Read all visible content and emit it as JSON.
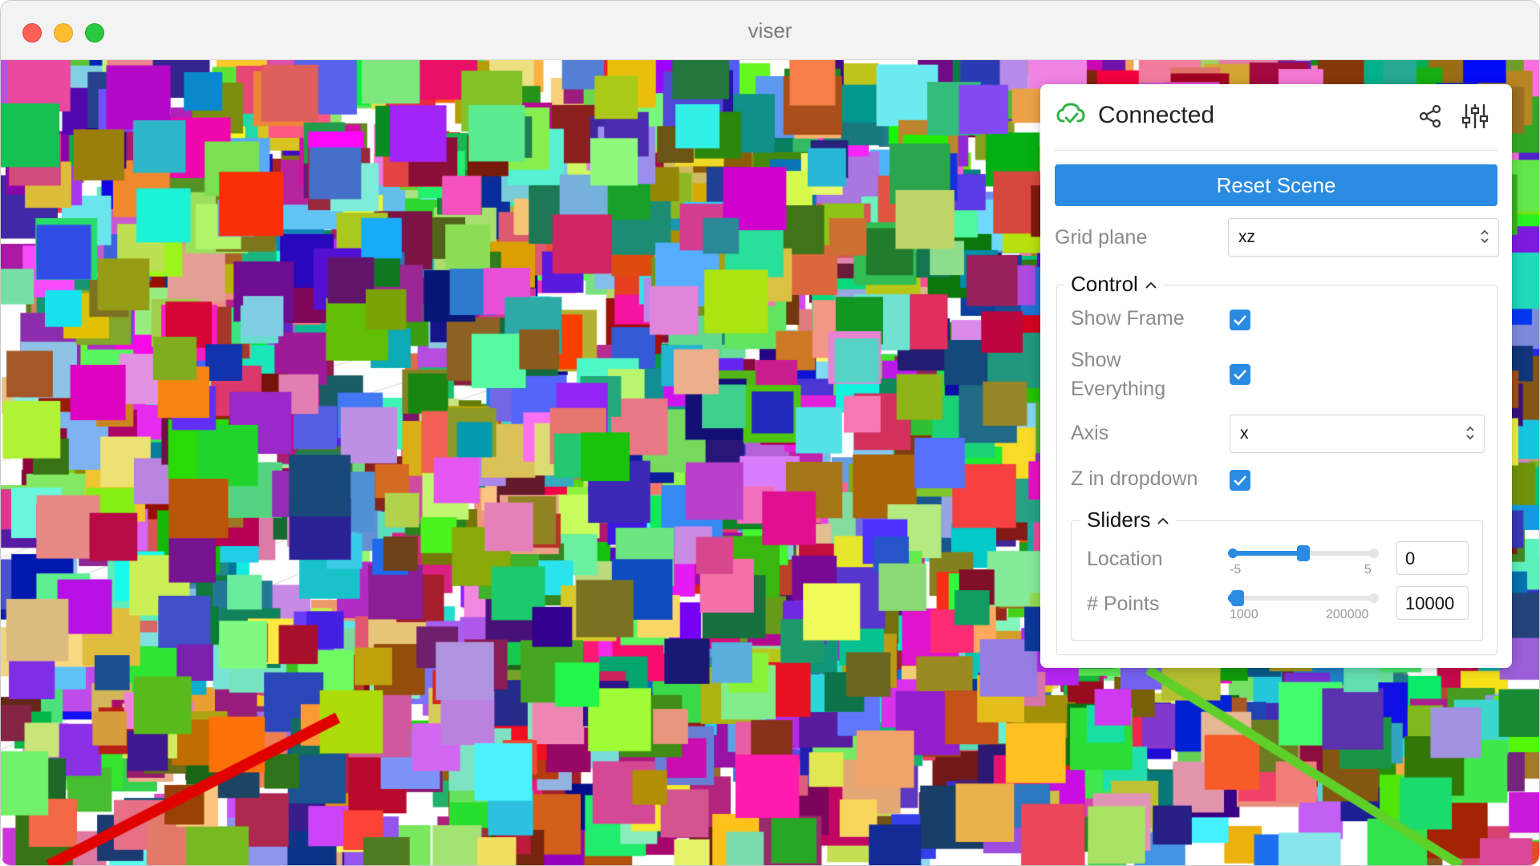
{
  "window": {
    "title": "viser"
  },
  "panel": {
    "status": "Connected",
    "reset_button": "Reset Scene",
    "grid_plane": {
      "label": "Grid plane",
      "value": "xz"
    },
    "control": {
      "title": "Control",
      "show_frame": {
        "label": "Show Frame",
        "checked": true
      },
      "show_everything": {
        "label_line1": "Show",
        "label_line2": "Everything",
        "checked": true
      },
      "axis": {
        "label": "Axis",
        "value": "x"
      },
      "z_in_dropdown": {
        "label": "Z in dropdown",
        "checked": true
      },
      "sliders": {
        "title": "Sliders",
        "location": {
          "label": "Location",
          "min_label": "-5",
          "max_label": "5",
          "value": "0",
          "fraction": 0.5
        },
        "points": {
          "label": "# Points",
          "min_label": "1000",
          "max_label": "200000",
          "value": "10000",
          "fraction": 0.045
        }
      }
    }
  },
  "colors": {
    "accent": "#2a8be3",
    "connected": "#2fb344"
  }
}
